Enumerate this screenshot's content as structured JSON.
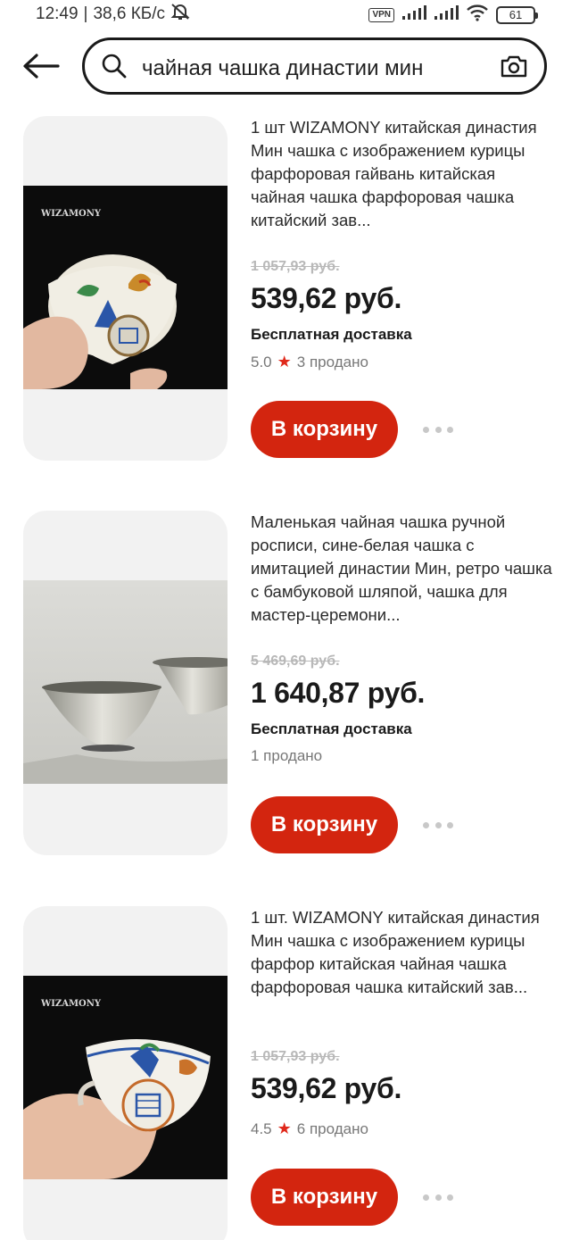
{
  "status_bar": {
    "time": "12:49",
    "network_speed": "38,6 КБ/с",
    "vpn": "VPN",
    "battery": "61"
  },
  "search": {
    "query": "чайная чашка династии мин"
  },
  "products": [
    {
      "title": "1 шт WIZAMONY китайская династия Мин чашка с изображением курицы фарфоровая гайвань китайская чайная чашка фарфоровая чашка китайский зав...",
      "old_price": "1 057,93 руб.",
      "price": "539,62 руб.",
      "shipping": "Бесплатная доставка",
      "rating": "5.0",
      "sold": "3 продано",
      "cart_label": "В корзину",
      "brand_watermark": "WIZAMONY"
    },
    {
      "title": "Маленькая чайная чашка ручной росписи, сине-белая чашка с имитацией династии Мин, ретро чашка с бамбуковой шляпой, чашка для мастер-церемони...",
      "old_price": "5 469,69 руб.",
      "price": "1 640,87 руб.",
      "shipping": "Бесплатная доставка",
      "sold": "1 продано",
      "cart_label": "В корзину"
    },
    {
      "title": "1 шт. WIZAMONY китайская династия Мин чашка с изображением курицы фарфор китайская чайная чашка фарфоровая чашка китайский зав...",
      "old_price": "1 057,93 руб.",
      "price": "539,62 руб.",
      "rating": "4.5",
      "sold": "6 продано",
      "cart_label": "В корзину",
      "brand_watermark": "WIZAMONY"
    }
  ],
  "colors": {
    "accent": "#d3250f",
    "star": "#e0291b",
    "card_bg": "#f2f2f2"
  }
}
